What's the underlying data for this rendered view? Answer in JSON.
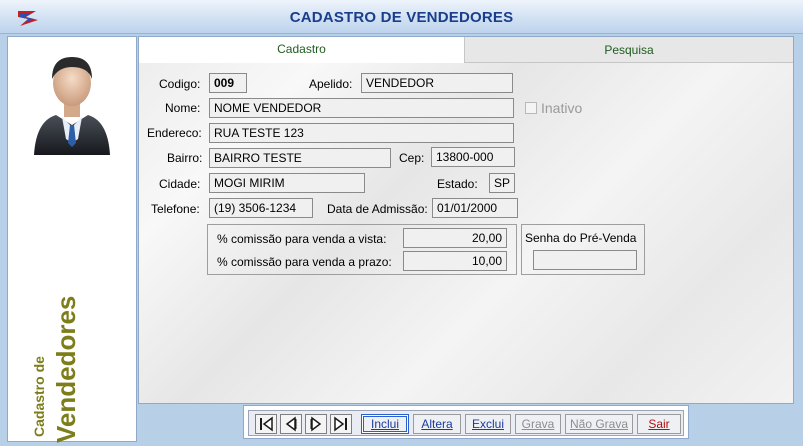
{
  "window": {
    "title": "CADASTRO DE VENDEDORES"
  },
  "side_panel": {
    "label_small": "Cadastro de",
    "label_big": "Vendedores"
  },
  "tabs": [
    {
      "label": "Cadastro"
    },
    {
      "label": "Pesquisa"
    }
  ],
  "form": {
    "codigo": {
      "label": "Codigo:",
      "value": "009"
    },
    "apelido": {
      "label": "Apelido:",
      "value": "VENDEDOR"
    },
    "nome": {
      "label": "Nome:",
      "value": "NOME VENDEDOR"
    },
    "inativo": {
      "label": "Inativo",
      "checked": false
    },
    "endereco": {
      "label": "Endereco:",
      "value": "RUA TESTE 123"
    },
    "bairro": {
      "label": "Bairro:",
      "value": "BAIRRO TESTE"
    },
    "cep": {
      "label": "Cep:",
      "value": "13800-000"
    },
    "cidade": {
      "label": "Cidade:",
      "value": "MOGI MIRIM"
    },
    "estado": {
      "label": "Estado:",
      "value": "SP"
    },
    "telefone": {
      "label": "Telefone:",
      "value": "(19) 3506-1234"
    },
    "admissao": {
      "label": "Data de Admissão:",
      "value": "01/01/2000"
    },
    "comissao_vista": {
      "label": "% comissão para venda a vista:",
      "value": "20,00"
    },
    "comissao_prazo": {
      "label": "% comissão para venda a prazo:",
      "value": "10,00"
    },
    "senha_prevenda": {
      "label": "Senha do Pré-Venda",
      "value": ""
    }
  },
  "toolbar": {
    "nav": [
      {
        "icon": "first-record-icon"
      },
      {
        "icon": "previous-record-icon"
      },
      {
        "icon": "next-record-icon"
      },
      {
        "icon": "last-record-icon"
      }
    ],
    "buttons": {
      "inclui": "Inclui",
      "altera": "Altera",
      "exclui": "Exclui",
      "grava": "Grava",
      "nao_grava": "Não Grava",
      "sair": "Sair"
    }
  },
  "colors": {
    "title": "#1a3e8c",
    "side_label": "#7d7d1a",
    "tab_text": "#1f5c1f",
    "exit": "#b01010"
  }
}
